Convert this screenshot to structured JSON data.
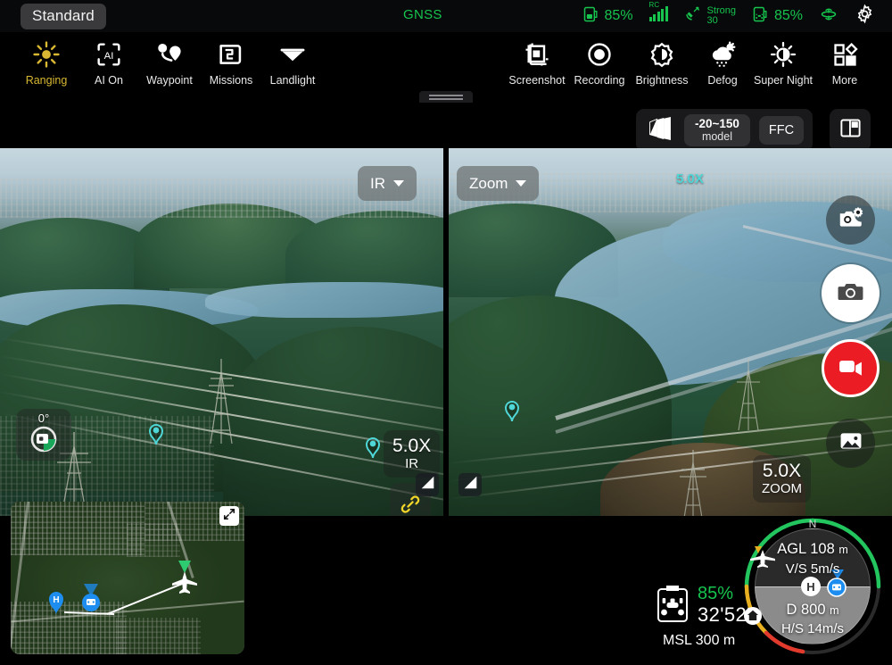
{
  "statusbar": {
    "mode_badge": "Standard",
    "gnss_label": "GNSS",
    "aircraft_battery": "85%",
    "rc_label": "RC",
    "signal_label": "Strong",
    "signal_value": "30",
    "rc_battery": "85%"
  },
  "toolbar": {
    "left_items": [
      {
        "label": "Ranging",
        "icon": "ranging-icon",
        "active": true
      },
      {
        "label": "AI On",
        "icon": "ai-icon",
        "active": false
      },
      {
        "label": "Waypoint",
        "icon": "waypoint-icon",
        "active": false
      },
      {
        "label": "Missions",
        "icon": "missions-icon",
        "active": false
      },
      {
        "label": "Landlight",
        "icon": "landlight-icon",
        "active": false
      }
    ],
    "right_items": [
      {
        "label": "Screenshot",
        "icon": "screenshot-icon"
      },
      {
        "label": "Recording",
        "icon": "recording-icon"
      },
      {
        "label": "Brightness",
        "icon": "brightness-icon"
      },
      {
        "label": "Defog",
        "icon": "defog-icon"
      },
      {
        "label": "Super Night",
        "icon": "super-night-icon"
      },
      {
        "label": "More",
        "icon": "more-icon"
      }
    ]
  },
  "ir_bar": {
    "palette_icon": "palette-icon",
    "model_range": "-20~150",
    "model_label": "model",
    "ffc_label": "FFC",
    "layout_icon": "split-layout-icon"
  },
  "panels": {
    "left": {
      "mode_label": "IR",
      "zoom_value": "5.0X",
      "zoom_label": "IR",
      "gimbal_angle": "0°",
      "link_icon": "link-icon",
      "corner_icon": "contrast-icon"
    },
    "right": {
      "mode_label": "Zoom",
      "top_zoom_tag": "5.0X",
      "zoom_value": "5.0X",
      "zoom_label": "ZOOM",
      "corner_icon": "contrast-icon"
    }
  },
  "camera_controls": {
    "settings_icon": "camera-settings-icon",
    "shutter_icon": "camera-icon",
    "record_icon": "video-record-icon",
    "gallery_icon": "gallery-icon"
  },
  "minimap": {
    "expand_icon": "expand-icon",
    "home_marker": "H",
    "rc_marker": "rc-location-icon",
    "aircraft_marker": "aircraft-icon"
  },
  "telemetry": {
    "battery_icon": "drone-battery-icon",
    "battery_percent": "85%",
    "flight_time": "32'52''",
    "msl_label": "MSL",
    "msl_value": "300",
    "msl_unit": "m"
  },
  "attitude": {
    "north_label": "N",
    "agl_label": "AGL",
    "agl_value": "108",
    "agl_unit": "m",
    "vs_label": "V/S",
    "vs_value": "5m/s",
    "dist_label": "D",
    "dist_value": "800",
    "dist_unit": "m",
    "hs_label": "H/S",
    "hs_value": "14m/s",
    "home_badge": "H",
    "rc_badge": "rc-icon"
  },
  "colors": {
    "green": "#16c44e",
    "cyan": "#4fd6d6",
    "amber": "#d8b832",
    "record_red": "#ec1c24"
  }
}
